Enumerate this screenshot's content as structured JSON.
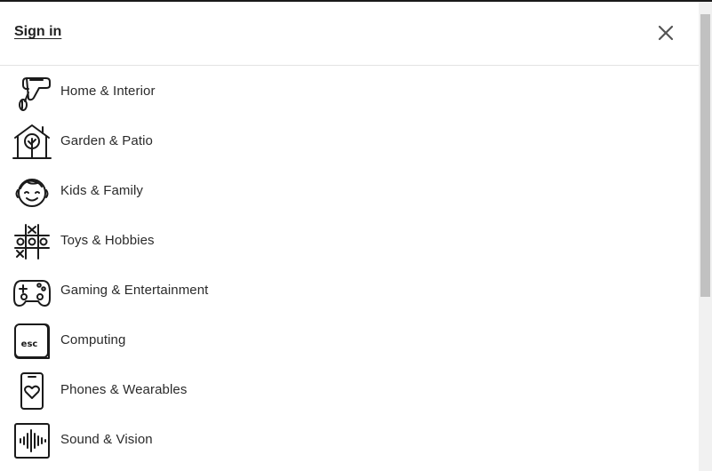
{
  "header": {
    "sign_in_label": "Sign in",
    "close_icon": "close-icon"
  },
  "menu": {
    "items": [
      {
        "label": "Home & Interior",
        "icon": "hand-mixer-icon"
      },
      {
        "label": "Garden & Patio",
        "icon": "house-tree-icon"
      },
      {
        "label": "Kids & Family",
        "icon": "child-face-icon"
      },
      {
        "label": "Toys & Hobbies",
        "icon": "tic-tac-toe-icon"
      },
      {
        "label": "Gaming & Entertainment",
        "icon": "gamepad-icon"
      },
      {
        "label": "Computing",
        "icon": "esc-key-icon"
      },
      {
        "label": "Phones & Wearables",
        "icon": "phone-heart-icon"
      },
      {
        "label": "Sound & Vision",
        "icon": "sound-wave-icon"
      }
    ]
  },
  "colors": {
    "icon_stroke": "#1a1a1a",
    "divider": "#e3e3e3",
    "scroll_thumb": "#c1c1c1",
    "scroll_track": "#f1f1f1"
  }
}
